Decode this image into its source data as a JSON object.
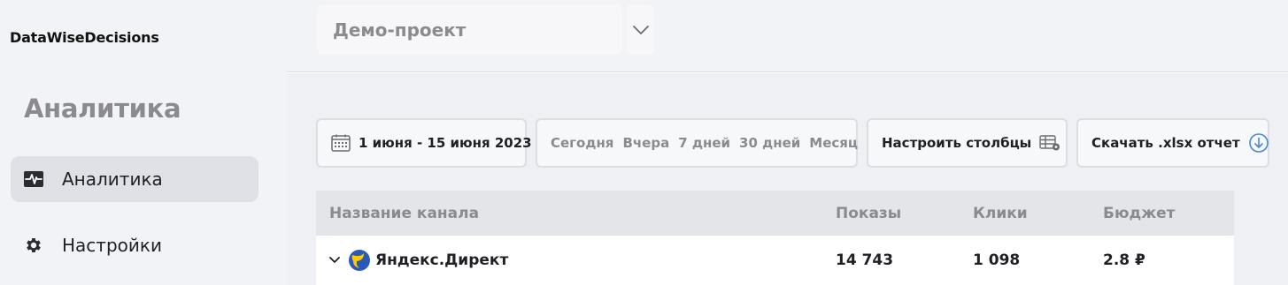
{
  "app": {
    "logo": "DataWiseDecisions"
  },
  "sidebar": {
    "section_title": "Аналитика",
    "items": [
      {
        "label": "Аналитика",
        "icon": "activity-icon",
        "active": true
      },
      {
        "label": "Настройки",
        "icon": "gear-icon",
        "active": false
      }
    ]
  },
  "header": {
    "project": "Демо-проект"
  },
  "toolbar": {
    "date_range": "1 июня - 15 июня 2023",
    "presets": [
      "Сегодня",
      "Вчера",
      "7 дней",
      "30 дней",
      "Месяц"
    ],
    "columns_label": "Настроить столбцы",
    "download_label": "Скачать .xlsx отчет"
  },
  "table": {
    "headers": [
      "Название канала",
      "Показы",
      "Клики",
      "Бюджет"
    ],
    "rows": [
      {
        "name": "Яндекс.Директ",
        "shows": "14 743",
        "clicks": "1 098",
        "budget": "2.8 ₽"
      }
    ]
  },
  "colors": {
    "accent": "#4a84d9",
    "sidebar_bg": "#f2f3f6",
    "active_item": "#dfe1e6"
  }
}
